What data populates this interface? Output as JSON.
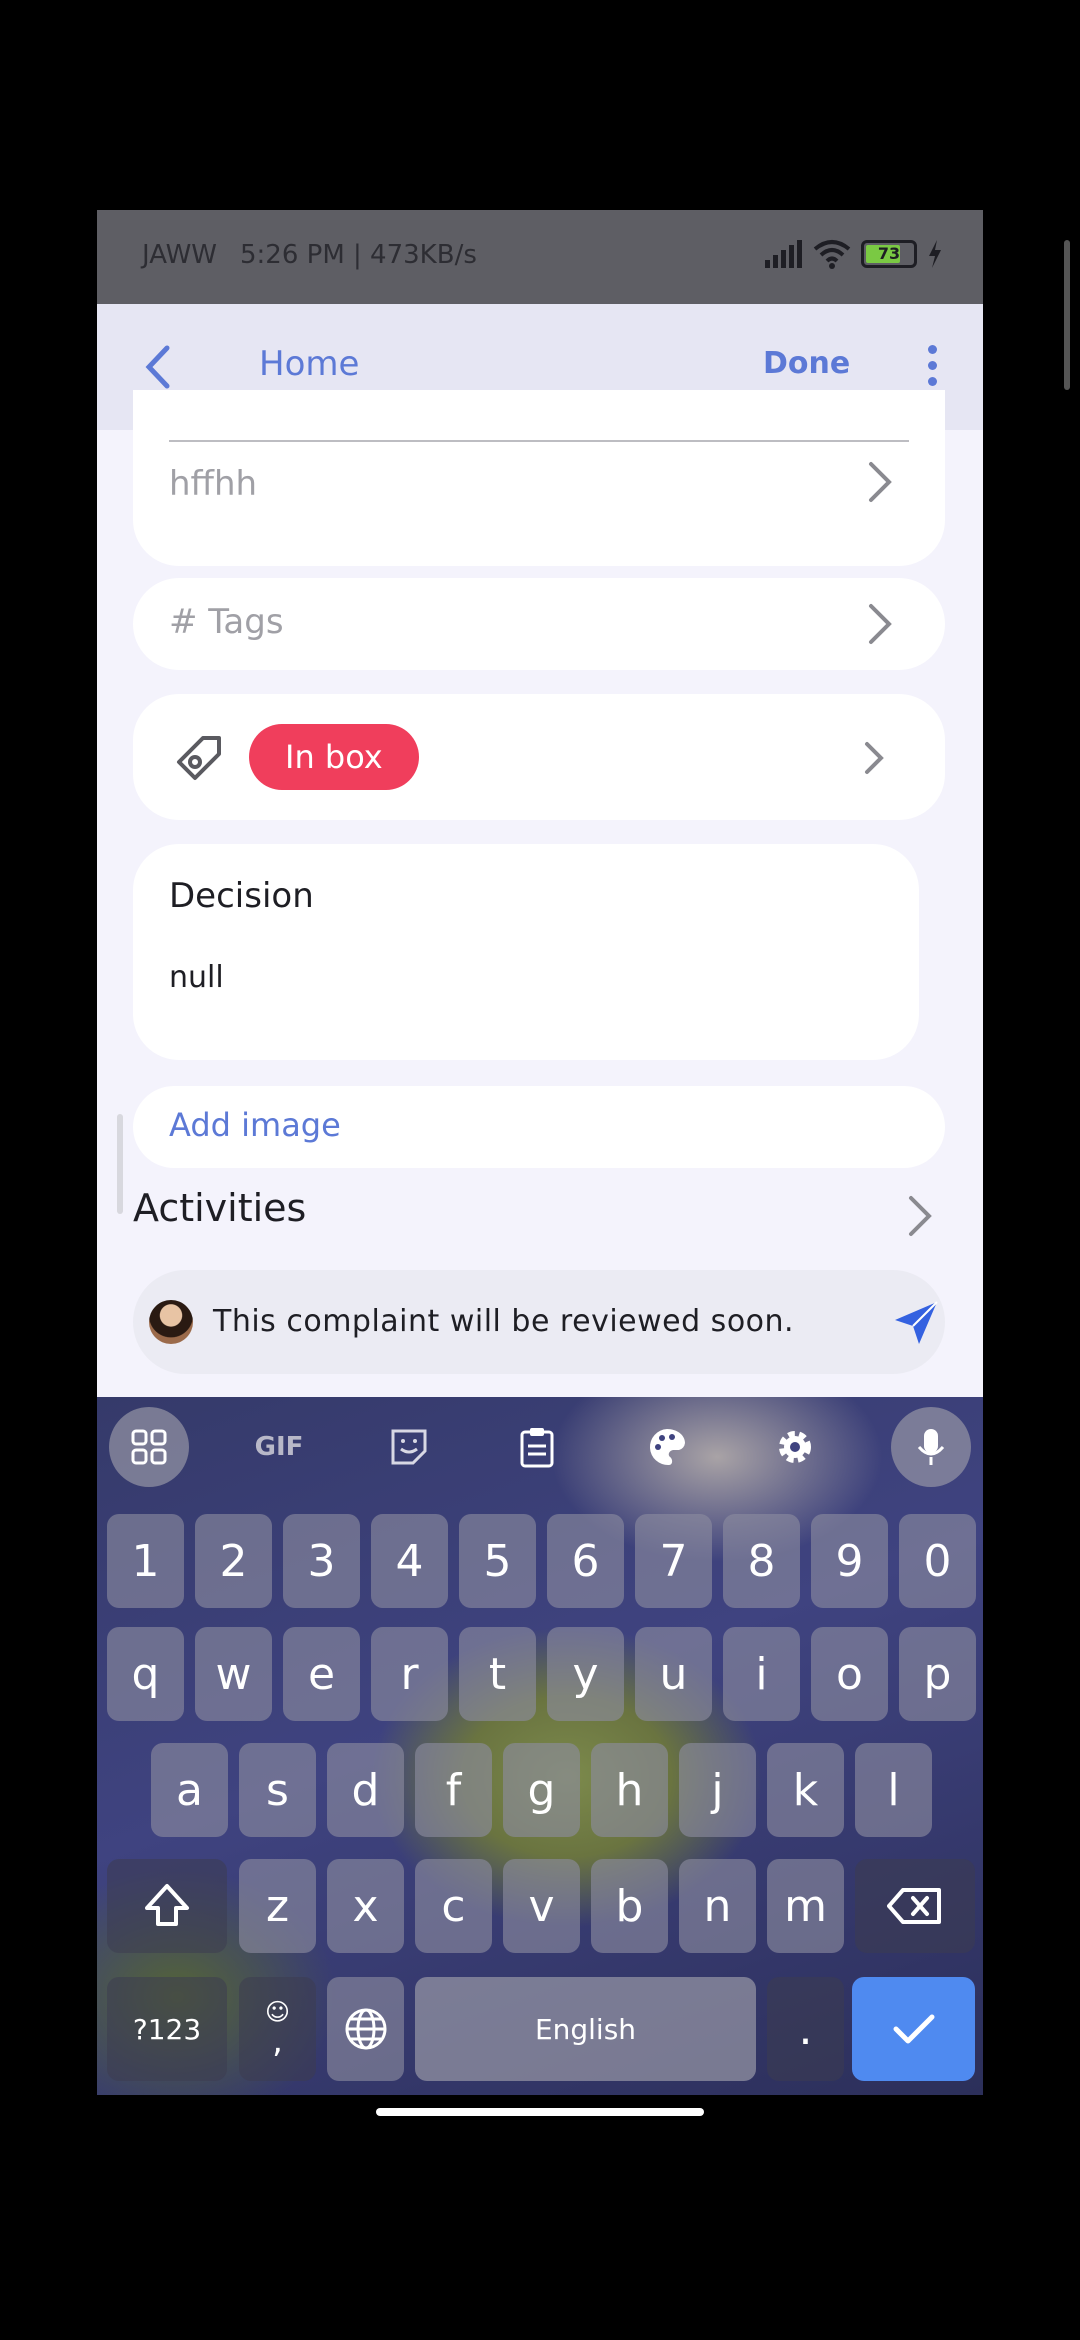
{
  "status_bar": {
    "carrier": "JAWW",
    "time_speed": "5:26 PM | 473KB/s",
    "battery_level": "73"
  },
  "header": {
    "back_icon": "chevron-left-icon",
    "title": "Home",
    "done_label": "Done",
    "more_icon": "more-vertical-icon"
  },
  "form": {
    "description_value": "hffhh",
    "tags_placeholder": "# Tags",
    "status_label": "In box",
    "decision_title": "Decision",
    "decision_value": "null",
    "add_image_label": "Add image",
    "activities_title": "Activities"
  },
  "comment": {
    "text": "This complaint will be reviewed soon.",
    "send_icon": "send-icon"
  },
  "keyboard": {
    "toolbar": [
      "apps-icon",
      "gif-icon",
      "sticker-icon",
      "clipboard-icon",
      "palette-icon",
      "settings-icon",
      "mic-icon"
    ],
    "gif_label": "GIF",
    "number_row": [
      "1",
      "2",
      "3",
      "4",
      "5",
      "6",
      "7",
      "8",
      "9",
      "0"
    ],
    "row1": [
      "q",
      "w",
      "e",
      "r",
      "t",
      "y",
      "u",
      "i",
      "o",
      "p"
    ],
    "row2": [
      "a",
      "s",
      "d",
      "f",
      "g",
      "h",
      "j",
      "k",
      "l"
    ],
    "row3": [
      "z",
      "x",
      "c",
      "v",
      "b",
      "n",
      "m"
    ],
    "symbols_label": "?123",
    "comma_label": ",",
    "space_label": "English",
    "period_label": ".",
    "colors": {
      "accent": "#4f8af0"
    }
  },
  "colors": {
    "accent": "#5c79d6",
    "status_pill": "#f03e5c",
    "background": "#f4f3fc"
  }
}
